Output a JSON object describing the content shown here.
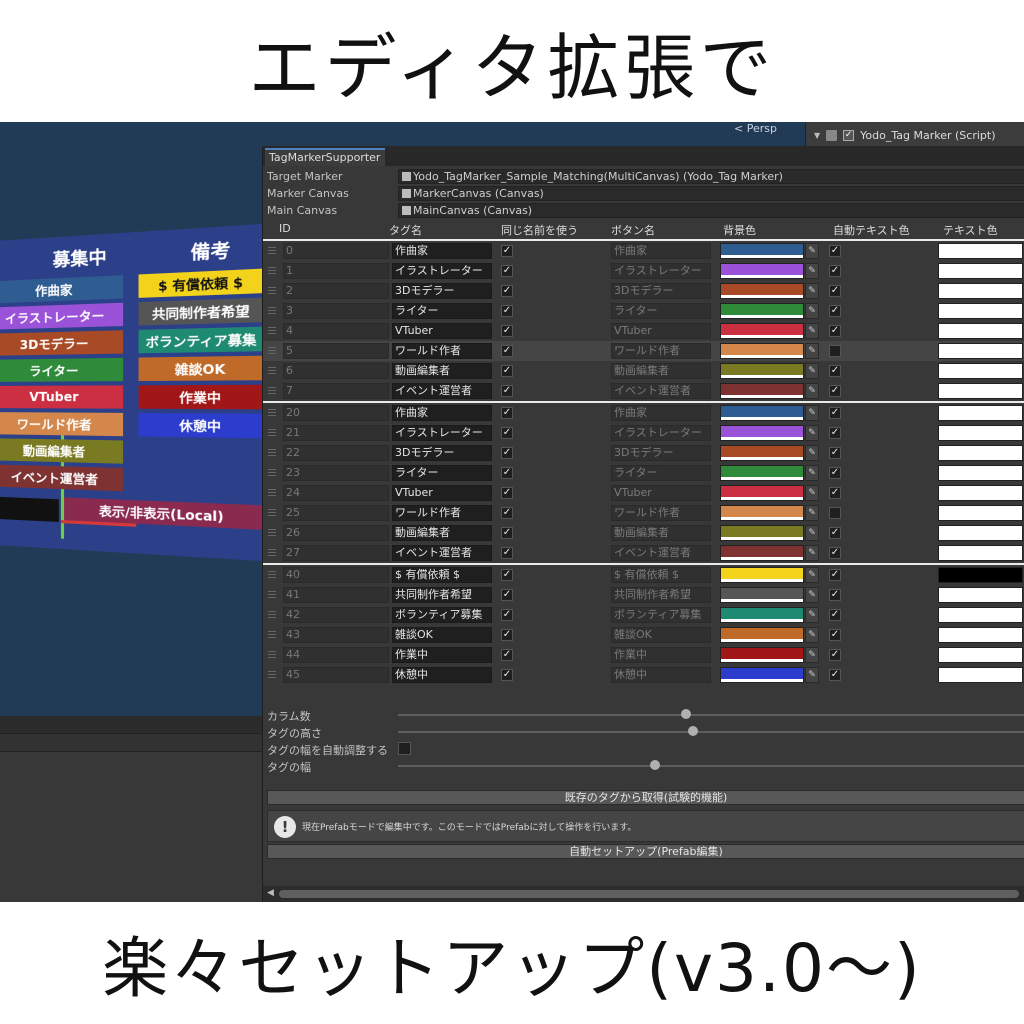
{
  "banner": {
    "top": "エディタ拡張で",
    "bottom": "楽々セットアップ(v3.0〜)"
  },
  "scene": {
    "persp_label": "< Persp",
    "world_canvas": {
      "headers": [
        "募集中",
        "備考"
      ],
      "left_tags": [
        {
          "label": "作曲家",
          "color": "#2f5d92"
        },
        {
          "label": "イラストレーター",
          "color": "#9a52d8"
        },
        {
          "label": "3Dモデラー",
          "color": "#a84a25"
        },
        {
          "label": "ライター",
          "color": "#2f8a3a"
        },
        {
          "label": "VTuber",
          "color": "#cc2f42"
        },
        {
          "label": "ワールド作者",
          "color": "#d4874a"
        },
        {
          "label": "動画編集者",
          "color": "#7a7a22"
        },
        {
          "label": "イベント運営者",
          "color": "#7e3232"
        }
      ],
      "right_tags": [
        {
          "label": "$ 有償依頼 $",
          "color": "#f2d21b",
          "text_color": "#111111"
        },
        {
          "label": "共同制作者希望",
          "color": "#555555",
          "text_color": "#ffffff"
        },
        {
          "label": "ボランティア募集",
          "color": "#1f8a72",
          "text_color": "#ffffff"
        },
        {
          "label": "雑談OK",
          "color": "#c06a2a",
          "text_color": "#ffffff"
        },
        {
          "label": "作業中",
          "color": "#a11616",
          "text_color": "#ffffff"
        },
        {
          "label": "休憩中",
          "color": "#2c3ccc",
          "text_color": "#ffffff"
        }
      ],
      "footer_label": "表示/非表示(Local)"
    }
  },
  "inspector": {
    "component_title": "Yodo_Tag Marker (Script)"
  },
  "window": {
    "tab": "TagMarkerSupporter",
    "properties": [
      {
        "label": "Target Marker",
        "value": "Yodo_TagMarker_Sample_Matching(MultiCanvas) (Yodo_Tag Marker)"
      },
      {
        "label": "Marker Canvas",
        "value": "MarkerCanvas (Canvas)"
      },
      {
        "label": "Main Canvas",
        "value": "MainCanvas (Canvas)"
      }
    ],
    "columns": [
      "ID",
      "タグ名",
      "同じ名前を使う",
      "ボタン名",
      "背景色",
      "自動テキスト色",
      "テキスト色"
    ],
    "groups": [
      {
        "rows": [
          {
            "id": "0",
            "tag": "作曲家",
            "same": true,
            "button": "作曲家",
            "bg": "#2f5d92",
            "auto": true,
            "text": "#ffffff"
          },
          {
            "id": "1",
            "tag": "イラストレーター",
            "same": true,
            "button": "イラストレーター",
            "bg": "#9a52d8",
            "auto": true,
            "text": "#ffffff"
          },
          {
            "id": "2",
            "tag": "3Dモデラー",
            "same": true,
            "button": "3Dモデラー",
            "bg": "#a84a25",
            "auto": true,
            "text": "#ffffff"
          },
          {
            "id": "3",
            "tag": "ライター",
            "same": true,
            "button": "ライター",
            "bg": "#2f8a3a",
            "auto": true,
            "text": "#ffffff"
          },
          {
            "id": "4",
            "tag": "VTuber",
            "same": true,
            "button": "VTuber",
            "bg": "#cc2f42",
            "auto": true,
            "text": "#ffffff"
          },
          {
            "id": "5",
            "tag": "ワールド作者",
            "same": true,
            "button": "ワールド作者",
            "bg": "#d4874a",
            "auto": false,
            "text": "#ffffff",
            "highlight": true
          },
          {
            "id": "6",
            "tag": "動画編集者",
            "same": true,
            "button": "動画編集者",
            "bg": "#7a7a22",
            "auto": true,
            "text": "#ffffff"
          },
          {
            "id": "7",
            "tag": "イベント運営者",
            "same": true,
            "button": "イベント運営者",
            "bg": "#7e3232",
            "auto": true,
            "text": "#ffffff"
          }
        ]
      },
      {
        "rows": [
          {
            "id": "20",
            "tag": "作曲家",
            "same": true,
            "button": "作曲家",
            "bg": "#2f5d92",
            "auto": true,
            "text": "#ffffff"
          },
          {
            "id": "21",
            "tag": "イラストレーター",
            "same": true,
            "button": "イラストレーター",
            "bg": "#9a52d8",
            "auto": true,
            "text": "#ffffff"
          },
          {
            "id": "22",
            "tag": "3Dモデラー",
            "same": true,
            "button": "3Dモデラー",
            "bg": "#a84a25",
            "auto": true,
            "text": "#ffffff"
          },
          {
            "id": "23",
            "tag": "ライター",
            "same": true,
            "button": "ライター",
            "bg": "#2f8a3a",
            "auto": true,
            "text": "#ffffff"
          },
          {
            "id": "24",
            "tag": "VTuber",
            "same": true,
            "button": "VTuber",
            "bg": "#cc2f42",
            "auto": true,
            "text": "#ffffff"
          },
          {
            "id": "25",
            "tag": "ワールド作者",
            "same": true,
            "button": "ワールド作者",
            "bg": "#d4874a",
            "auto": false,
            "text": "#ffffff"
          },
          {
            "id": "26",
            "tag": "動画編集者",
            "same": true,
            "button": "動画編集者",
            "bg": "#7a7a22",
            "auto": true,
            "text": "#ffffff"
          },
          {
            "id": "27",
            "tag": "イベント運営者",
            "same": true,
            "button": "イベント運営者",
            "bg": "#7e3232",
            "auto": true,
            "text": "#ffffff"
          }
        ]
      },
      {
        "rows": [
          {
            "id": "40",
            "tag": "$ 有償依頼 $",
            "same": true,
            "button": "$ 有償依頼 $",
            "bg": "#f2d21b",
            "auto": true,
            "text": "#000000"
          },
          {
            "id": "41",
            "tag": "共同制作者希望",
            "same": true,
            "button": "共同制作者希望",
            "bg": "#555555",
            "auto": true,
            "text": "#ffffff"
          },
          {
            "id": "42",
            "tag": "ボランティア募集",
            "same": true,
            "button": "ボランティア募集",
            "bg": "#1f8a72",
            "auto": true,
            "text": "#ffffff"
          },
          {
            "id": "43",
            "tag": "雑談OK",
            "same": true,
            "button": "雑談OK",
            "bg": "#c06a2a",
            "auto": true,
            "text": "#ffffff"
          },
          {
            "id": "44",
            "tag": "作業中",
            "same": true,
            "button": "作業中",
            "bg": "#a11616",
            "auto": true,
            "text": "#ffffff"
          },
          {
            "id": "45",
            "tag": "休憩中",
            "same": true,
            "button": "休憩中",
            "bg": "#2c3ccc",
            "auto": true,
            "text": "#ffffff"
          }
        ]
      }
    ],
    "settings": {
      "column_count_label": "カラム数",
      "column_count_level": 0.46,
      "tag_height_label": "タグの高さ",
      "tag_height_level": 0.47,
      "auto_width_label": "タグの幅を自動調整する",
      "tag_width_label": "タグの幅",
      "tag_width_level": 0.41,
      "fetch_button": "既存のタグから取得(試験的機能)",
      "help_text": "現在Prefabモードで編集中です。このモードではPrefabに対して操作を行います。",
      "auto_setup_button": "自動セットアップ(Prefab編集)"
    }
  }
}
